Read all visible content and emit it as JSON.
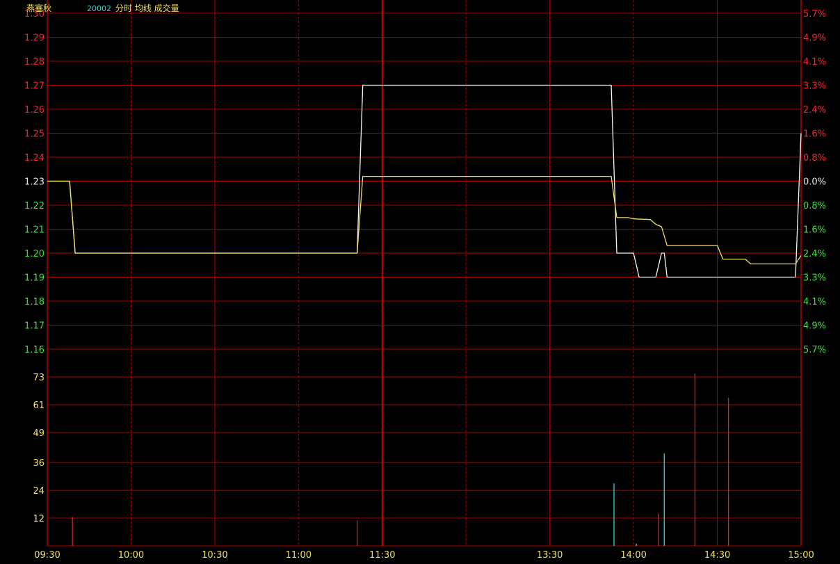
{
  "header": {
    "stock_name": "燕塞秋",
    "code": "20002",
    "labels": "分时 均线 成交量"
  },
  "colors": {
    "background": "#000000",
    "grid": "#b00000",
    "axis": "#d00000",
    "up": "#ff2030",
    "down": "#30e830",
    "neutral": "#e8e8e8",
    "price_line": "#f8f8f8",
    "avg_line": "#f0e060",
    "volume_label": "#f0e060",
    "volume_up": "#e02020",
    "volume_down": "#20e0e0",
    "time_label": "#f0e060",
    "code": "#40d0d0",
    "stock_name": "#f0e060"
  },
  "chart_data": {
    "type": "line",
    "time_ticks": [
      "09:30",
      "10:00",
      "10:30",
      "11:00",
      "11:30",
      "13:30",
      "14:00",
      "14:30",
      "15:00"
    ],
    "prev_close": 1.23,
    "price_range": [
      1.16,
      1.3
    ],
    "price_ticks": [
      "1.30",
      "1.29",
      "1.28",
      "1.27",
      "1.26",
      "1.25",
      "1.24",
      "1.23",
      "1.22",
      "1.21",
      "1.20",
      "1.19",
      "1.18",
      "1.17",
      "1.16"
    ],
    "pct_ticks": [
      "5.7%",
      "4.9%",
      "4.1%",
      "3.3%",
      "2.4%",
      "1.6%",
      "0.8%",
      "0.0%",
      "0.8%",
      "1.6%",
      "2.4%",
      "3.3%",
      "4.1%",
      "4.9%",
      "5.7%"
    ],
    "volume_range": [
      0,
      85
    ],
    "volume_ticks": [
      "73",
      "61",
      "49",
      "36",
      "24",
      "12"
    ],
    "series": [
      {
        "key": "price",
        "points": [
          [
            0,
            1.23
          ],
          [
            8,
            1.23
          ],
          [
            10,
            1.2
          ],
          [
            111,
            1.2
          ],
          [
            113,
            1.27
          ],
          [
            202,
            1.27
          ],
          [
            204,
            1.2
          ],
          [
            210,
            1.2
          ],
          [
            212,
            1.19
          ],
          [
            218,
            1.19
          ],
          [
            220,
            1.2
          ],
          [
            221,
            1.2
          ],
          [
            222,
            1.19
          ],
          [
            230,
            1.19
          ],
          [
            260,
            1.19
          ],
          [
            268,
            1.19
          ],
          [
            269,
            1.22
          ],
          [
            270,
            1.25
          ]
        ]
      },
      {
        "key": "average",
        "points": [
          [
            0,
            1.23
          ],
          [
            8,
            1.23
          ],
          [
            10,
            1.2
          ],
          [
            111,
            1.2
          ],
          [
            113,
            1.232
          ],
          [
            202,
            1.232
          ],
          [
            204,
            1.2148
          ],
          [
            208,
            1.2148
          ],
          [
            210,
            1.2143
          ],
          [
            216,
            1.214
          ],
          [
            218,
            1.212
          ],
          [
            220,
            1.211
          ],
          [
            222,
            1.2032
          ],
          [
            240,
            1.2032
          ],
          [
            242,
            1.1975
          ],
          [
            250,
            1.1975
          ],
          [
            252,
            1.1955
          ],
          [
            268,
            1.1955
          ],
          [
            270,
            1.199
          ]
        ]
      }
    ],
    "volume": [
      {
        "t": 9,
        "v": 12.5,
        "dir": "up"
      },
      {
        "t": 111,
        "v": 11,
        "dir": "up"
      },
      {
        "t": 203,
        "v": 27,
        "dir": "down"
      },
      {
        "t": 211,
        "v": 1,
        "dir": "down"
      },
      {
        "t": 219,
        "v": 14,
        "dir": "up"
      },
      {
        "t": 221,
        "v": 40,
        "dir": "down"
      },
      {
        "t": 232,
        "v": 74.5,
        "dir": "up"
      },
      {
        "t": 244,
        "v": 64,
        "dir": "up"
      }
    ]
  }
}
